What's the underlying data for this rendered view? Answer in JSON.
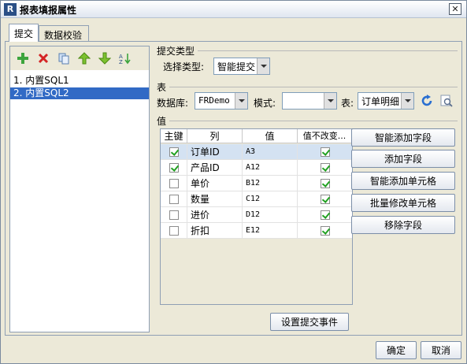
{
  "window": {
    "title": "报表填报属性",
    "close_symbol": "✕"
  },
  "tabs": [
    {
      "label": "提交",
      "active": true
    },
    {
      "label": "数据校验",
      "active": false
    }
  ],
  "toolbar_icons": [
    "add-icon",
    "delete-icon",
    "copy-icon",
    "move-up-icon",
    "move-down-icon",
    "sort-icon"
  ],
  "list": {
    "items": [
      {
        "label": "1.  内置SQL1",
        "selected": false
      },
      {
        "label": "2.  内置SQL2",
        "selected": true
      }
    ]
  },
  "submit_type": {
    "section_label": "提交类型",
    "field_label": "选择类型:",
    "value": "智能提交"
  },
  "table_section": {
    "section_label": "表",
    "db_label": "数据库:",
    "db_value": "FRDemo",
    "schema_label": "模式:",
    "schema_value": "",
    "table_label": "表:",
    "table_value": "订单明细"
  },
  "value_section": {
    "section_label": "值",
    "headers": [
      "主键",
      "列",
      "值",
      "值不改变..."
    ],
    "rows": [
      {
        "key": true,
        "column": "订单ID",
        "value": "A3",
        "unchanged": true,
        "selected": true
      },
      {
        "key": true,
        "column": "产品ID",
        "value": "A12",
        "unchanged": true,
        "selected": false
      },
      {
        "key": false,
        "column": "单价",
        "value": "B12",
        "unchanged": true,
        "selected": false
      },
      {
        "key": false,
        "column": "数量",
        "value": "C12",
        "unchanged": true,
        "selected": false
      },
      {
        "key": false,
        "column": "进价",
        "value": "D12",
        "unchanged": true,
        "selected": false
      },
      {
        "key": false,
        "column": "折扣",
        "value": "E12",
        "unchanged": true,
        "selected": false
      }
    ]
  },
  "side_buttons": [
    "智能添加字段",
    "添加字段",
    "智能添加单元格",
    "批量修改单元格",
    "移除字段"
  ],
  "submit_event_button": "设置提交事件",
  "footer": {
    "ok": "确定",
    "cancel": "取消"
  },
  "colors": {
    "selection": "#316ac5",
    "check": "#21a121",
    "refresh": "#2a6fd1"
  }
}
